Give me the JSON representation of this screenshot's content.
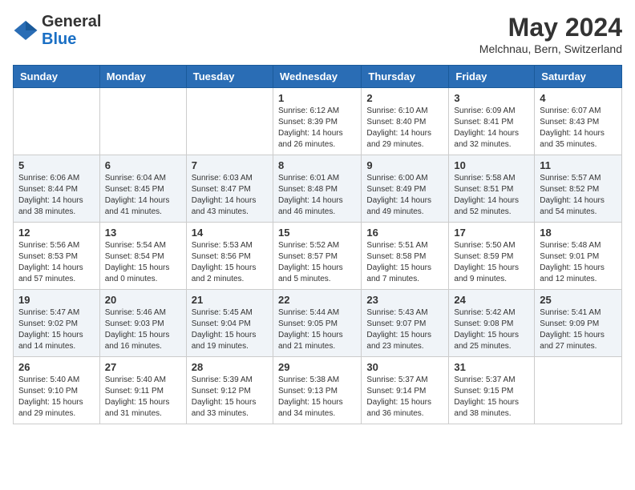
{
  "header": {
    "logo_general": "General",
    "logo_blue": "Blue",
    "month_year": "May 2024",
    "location": "Melchnau, Bern, Switzerland"
  },
  "days_of_week": [
    "Sunday",
    "Monday",
    "Tuesday",
    "Wednesday",
    "Thursday",
    "Friday",
    "Saturday"
  ],
  "weeks": [
    [
      {
        "day": "",
        "info": ""
      },
      {
        "day": "",
        "info": ""
      },
      {
        "day": "",
        "info": ""
      },
      {
        "day": "1",
        "info": "Sunrise: 6:12 AM\nSunset: 8:39 PM\nDaylight: 14 hours and 26 minutes."
      },
      {
        "day": "2",
        "info": "Sunrise: 6:10 AM\nSunset: 8:40 PM\nDaylight: 14 hours and 29 minutes."
      },
      {
        "day": "3",
        "info": "Sunrise: 6:09 AM\nSunset: 8:41 PM\nDaylight: 14 hours and 32 minutes."
      },
      {
        "day": "4",
        "info": "Sunrise: 6:07 AM\nSunset: 8:43 PM\nDaylight: 14 hours and 35 minutes."
      }
    ],
    [
      {
        "day": "5",
        "info": "Sunrise: 6:06 AM\nSunset: 8:44 PM\nDaylight: 14 hours and 38 minutes."
      },
      {
        "day": "6",
        "info": "Sunrise: 6:04 AM\nSunset: 8:45 PM\nDaylight: 14 hours and 41 minutes."
      },
      {
        "day": "7",
        "info": "Sunrise: 6:03 AM\nSunset: 8:47 PM\nDaylight: 14 hours and 43 minutes."
      },
      {
        "day": "8",
        "info": "Sunrise: 6:01 AM\nSunset: 8:48 PM\nDaylight: 14 hours and 46 minutes."
      },
      {
        "day": "9",
        "info": "Sunrise: 6:00 AM\nSunset: 8:49 PM\nDaylight: 14 hours and 49 minutes."
      },
      {
        "day": "10",
        "info": "Sunrise: 5:58 AM\nSunset: 8:51 PM\nDaylight: 14 hours and 52 minutes."
      },
      {
        "day": "11",
        "info": "Sunrise: 5:57 AM\nSunset: 8:52 PM\nDaylight: 14 hours and 54 minutes."
      }
    ],
    [
      {
        "day": "12",
        "info": "Sunrise: 5:56 AM\nSunset: 8:53 PM\nDaylight: 14 hours and 57 minutes."
      },
      {
        "day": "13",
        "info": "Sunrise: 5:54 AM\nSunset: 8:54 PM\nDaylight: 15 hours and 0 minutes."
      },
      {
        "day": "14",
        "info": "Sunrise: 5:53 AM\nSunset: 8:56 PM\nDaylight: 15 hours and 2 minutes."
      },
      {
        "day": "15",
        "info": "Sunrise: 5:52 AM\nSunset: 8:57 PM\nDaylight: 15 hours and 5 minutes."
      },
      {
        "day": "16",
        "info": "Sunrise: 5:51 AM\nSunset: 8:58 PM\nDaylight: 15 hours and 7 minutes."
      },
      {
        "day": "17",
        "info": "Sunrise: 5:50 AM\nSunset: 8:59 PM\nDaylight: 15 hours and 9 minutes."
      },
      {
        "day": "18",
        "info": "Sunrise: 5:48 AM\nSunset: 9:01 PM\nDaylight: 15 hours and 12 minutes."
      }
    ],
    [
      {
        "day": "19",
        "info": "Sunrise: 5:47 AM\nSunset: 9:02 PM\nDaylight: 15 hours and 14 minutes."
      },
      {
        "day": "20",
        "info": "Sunrise: 5:46 AM\nSunset: 9:03 PM\nDaylight: 15 hours and 16 minutes."
      },
      {
        "day": "21",
        "info": "Sunrise: 5:45 AM\nSunset: 9:04 PM\nDaylight: 15 hours and 19 minutes."
      },
      {
        "day": "22",
        "info": "Sunrise: 5:44 AM\nSunset: 9:05 PM\nDaylight: 15 hours and 21 minutes."
      },
      {
        "day": "23",
        "info": "Sunrise: 5:43 AM\nSunset: 9:07 PM\nDaylight: 15 hours and 23 minutes."
      },
      {
        "day": "24",
        "info": "Sunrise: 5:42 AM\nSunset: 9:08 PM\nDaylight: 15 hours and 25 minutes."
      },
      {
        "day": "25",
        "info": "Sunrise: 5:41 AM\nSunset: 9:09 PM\nDaylight: 15 hours and 27 minutes."
      }
    ],
    [
      {
        "day": "26",
        "info": "Sunrise: 5:40 AM\nSunset: 9:10 PM\nDaylight: 15 hours and 29 minutes."
      },
      {
        "day": "27",
        "info": "Sunrise: 5:40 AM\nSunset: 9:11 PM\nDaylight: 15 hours and 31 minutes."
      },
      {
        "day": "28",
        "info": "Sunrise: 5:39 AM\nSunset: 9:12 PM\nDaylight: 15 hours and 33 minutes."
      },
      {
        "day": "29",
        "info": "Sunrise: 5:38 AM\nSunset: 9:13 PM\nDaylight: 15 hours and 34 minutes."
      },
      {
        "day": "30",
        "info": "Sunrise: 5:37 AM\nSunset: 9:14 PM\nDaylight: 15 hours and 36 minutes."
      },
      {
        "day": "31",
        "info": "Sunrise: 5:37 AM\nSunset: 9:15 PM\nDaylight: 15 hours and 38 minutes."
      },
      {
        "day": "",
        "info": ""
      }
    ]
  ]
}
